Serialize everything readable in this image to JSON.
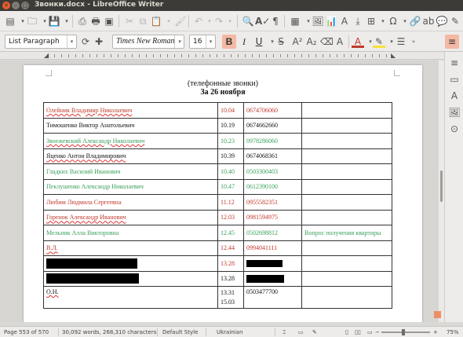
{
  "window": {
    "title": "Звонки.docx - LibreOffice Writer"
  },
  "toolbar": {
    "paragraph_style": "List Paragraph",
    "font_name": "Times New Roman",
    "font_size": "16",
    "bold_label": "B",
    "italic_label": "I",
    "underline_label": "U"
  },
  "document": {
    "subtitle": "(телефонные звонки)",
    "date_heading": "За 26 ноября",
    "rows": [
      {
        "name": "Олейник Владимир Николаевич",
        "time": "10.04",
        "phone": "0674706060",
        "note": "",
        "color": "red"
      },
      {
        "name": "Тимошенко Виктор Анатольевич",
        "time": "10.19",
        "phone": "0674662660",
        "note": "",
        "color": "black"
      },
      {
        "name": "Звоежевский Александр Николаевич",
        "time": "10.23",
        "phone": "0978286060",
        "note": "",
        "color": "green"
      },
      {
        "name": "Яценко Антон Владимирович",
        "time": "10.39",
        "phone": "0674068361",
        "note": "",
        "color": "black"
      },
      {
        "name": "Гладких Василий Иванович",
        "time": "10.40",
        "phone": "0503300403",
        "note": "",
        "color": "green"
      },
      {
        "name": "Пеклушенко Александр Николаевич",
        "time": "10.47",
        "phone": "0612390100",
        "note": "",
        "color": "green"
      },
      {
        "name": "Любим Людмила Сергеевна",
        "time": "11.12",
        "phone": "0955582351",
        "note": "",
        "color": "red"
      },
      {
        "name": "Горенок Александр Иванович",
        "time": "12.03",
        "phone": "0981594975",
        "note": "",
        "color": "red"
      },
      {
        "name": "Мельник Алла Викторовна",
        "time": "12.45",
        "phone": "0502698812",
        "note": "Вопрос получения квартиры",
        "color": "green"
      },
      {
        "name": "В.Л.",
        "time": "12.44",
        "phone": "0994041111",
        "note": "",
        "color": "red"
      }
    ],
    "redacted_row_1_time": "13.28",
    "redacted_row_2_time": "13.28",
    "last_row": {
      "name": "О.Н.",
      "time_1": "13.31",
      "time_2": "15.03",
      "phone": "0503477700"
    }
  },
  "statusbar": {
    "page": "Page 553 of 570",
    "words": "30,092 words, 268,310 characters",
    "page_style": "Default Style",
    "language": "Ukrainian",
    "zoom": "75%"
  },
  "colors": {
    "red_text": "#c0392b",
    "green_text": "#3aa05b",
    "active_button": "#f4b9a4",
    "accent_orange": "#ef8e64"
  }
}
